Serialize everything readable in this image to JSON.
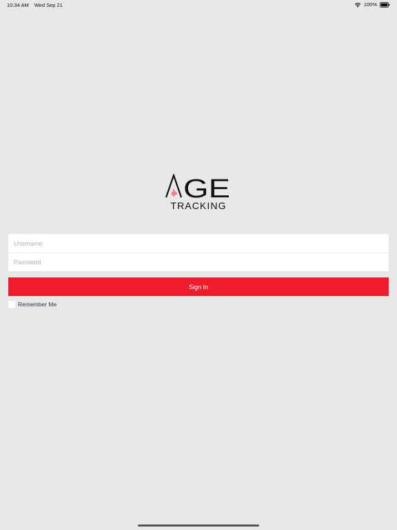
{
  "status_bar": {
    "time": "10:34 AM",
    "date": "Wed Sep 21",
    "battery": "100%",
    "wifi_icon": "wifi-icon",
    "battery_icon": "battery-icon"
  },
  "logo": {
    "wordmark": "AGE",
    "subtitle": "TRACKING",
    "accent_color": "#ee1c2e"
  },
  "login": {
    "username_placeholder": "Username",
    "username_value": "",
    "password_placeholder": "Password",
    "password_value": "",
    "sign_in_label": "Sign In",
    "remember_label": "Remember Me",
    "remember_checked": false
  },
  "colors": {
    "background": "#e8e8e8",
    "primary": "#ee1c2e"
  }
}
